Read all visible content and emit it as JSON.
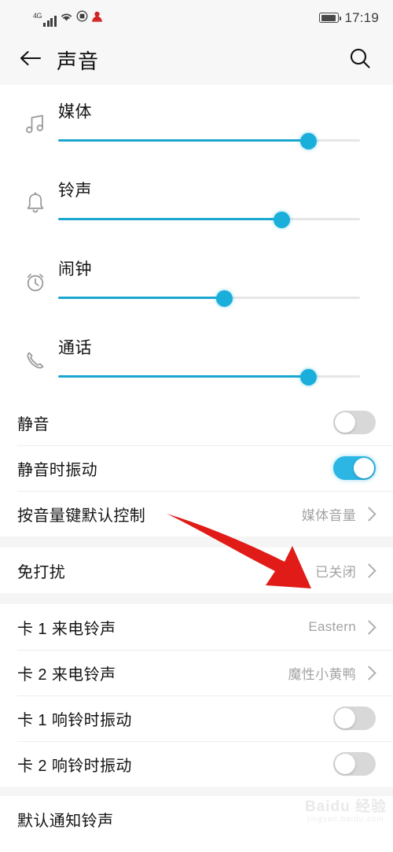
{
  "status_bar": {
    "network_label": "4G",
    "signal_icon": "signal-bars-icon",
    "wifi_icon": "wifi-icon",
    "vpn_icon": "vpn-circle-icon",
    "app_icon": "notification-app-icon",
    "battery_icon": "battery-icon",
    "time": "17:19"
  },
  "header": {
    "back_icon": "back-arrow-icon",
    "title": "声音",
    "search_icon": "search-icon"
  },
  "volume_sliders": [
    {
      "icon": "music-note-icon",
      "label": "媒体",
      "percent": 83
    },
    {
      "icon": "bell-icon",
      "label": "铃声",
      "percent": 74
    },
    {
      "icon": "alarm-clock-icon",
      "label": "闹钟",
      "percent": 55
    },
    {
      "icon": "phone-handset-icon",
      "label": "通话",
      "percent": 83
    }
  ],
  "toggle_rows": [
    {
      "label": "静音",
      "state": "off"
    },
    {
      "label": "静音时振动",
      "state": "on"
    }
  ],
  "volume_key_row": {
    "label": "按音量键默认控制",
    "value": "媒体音量",
    "chevron_icon": "chevron-right-icon"
  },
  "do_not_disturb_row": {
    "label": "免打扰",
    "value": "已关闭",
    "chevron_icon": "chevron-right-icon"
  },
  "sim_rows": [
    {
      "label": "卡 1 来电铃声",
      "value": "Eastern",
      "type": "value",
      "chevron_icon": "chevron-right-icon"
    },
    {
      "label": "卡 2 来电铃声",
      "value": "魔性小黄鸭",
      "type": "value",
      "chevron_icon": "chevron-right-icon"
    },
    {
      "label": "卡 1 响铃时振动",
      "state": "off",
      "type": "toggle"
    },
    {
      "label": "卡 2 响铃时振动",
      "state": "off",
      "type": "toggle"
    }
  ],
  "partial_row": {
    "label": "默认通知铃声"
  },
  "annotation": {
    "arrow_icon": "red-pointer-arrow",
    "color": "#e01b18"
  },
  "watermark": {
    "main": "Baidu 经验",
    "sub": "jingyan.baidu.com"
  },
  "colors": {
    "accent": "#1aafdb",
    "toggle_on": "#2bb6e3",
    "toggle_off": "#d8d8d8",
    "header_bg": "#f7f7f7",
    "gap_bg": "#f5f5f5"
  }
}
